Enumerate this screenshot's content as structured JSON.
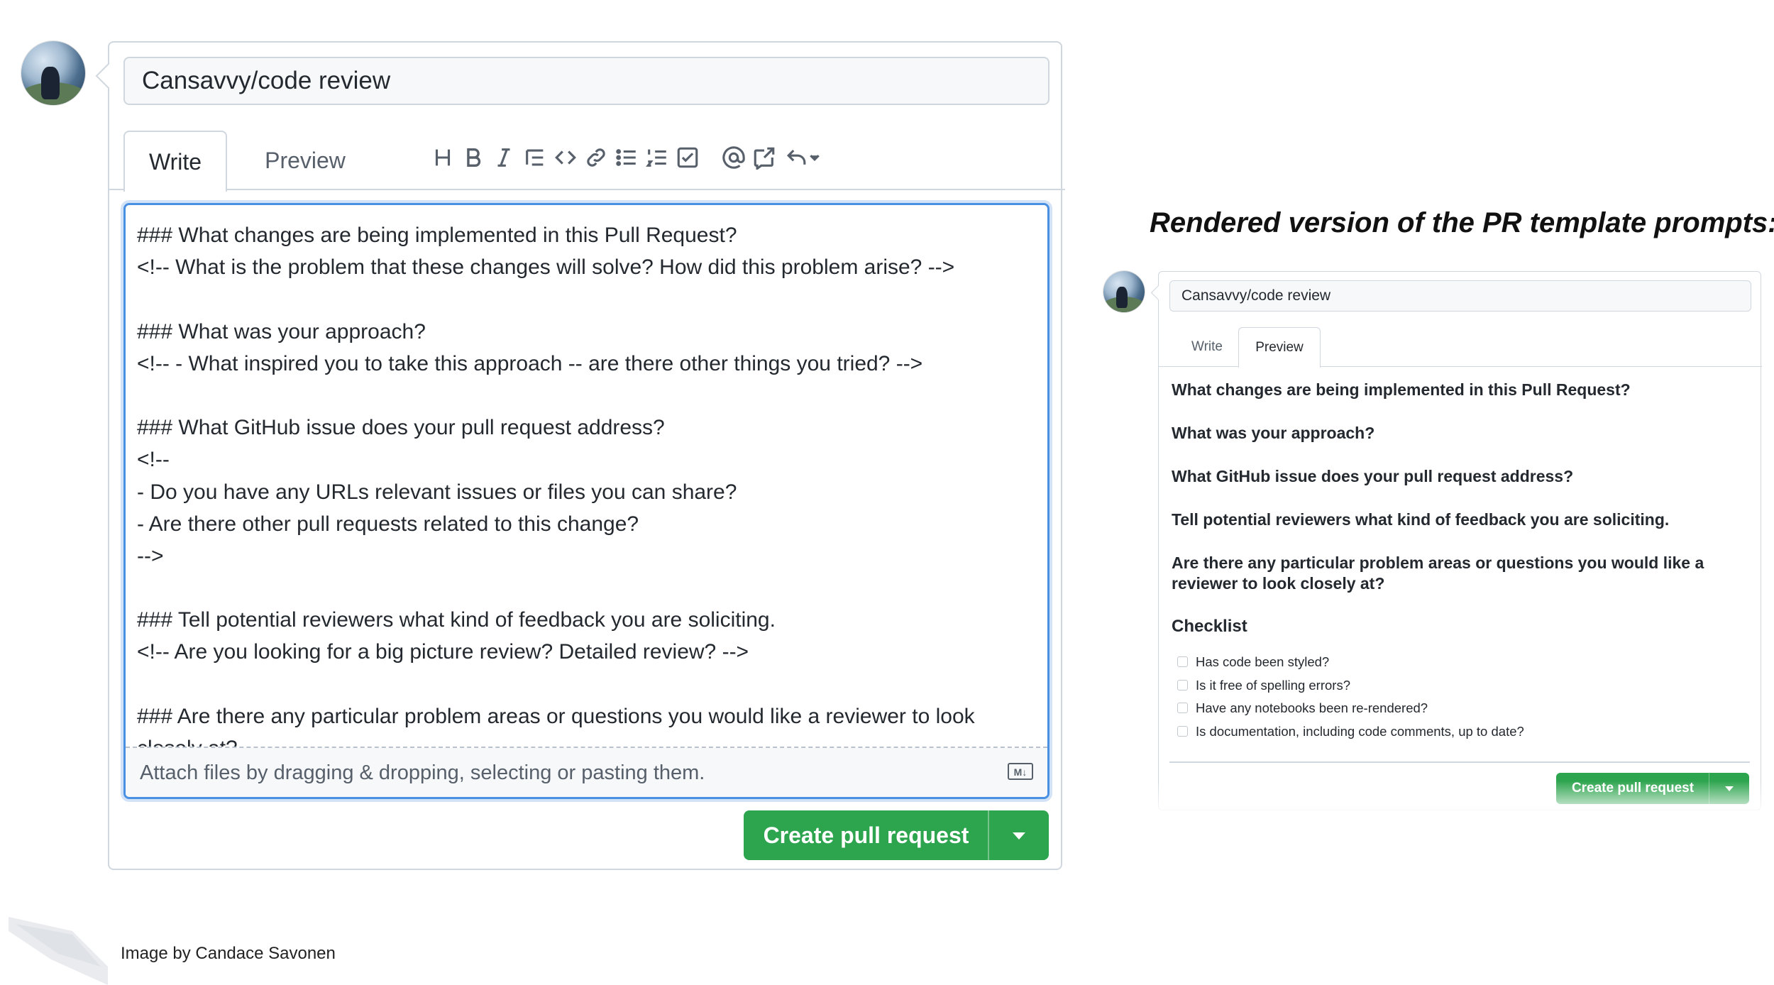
{
  "left_editor": {
    "title_value": "Cansavvy/code review",
    "tabs": [
      "Write",
      "Preview"
    ],
    "toolbar_icons": [
      "heading-icon",
      "bold-icon",
      "italic-icon",
      "quote-icon",
      "code-icon",
      "link-icon",
      "bulleted-list-icon",
      "numbered-list-icon",
      "task-list-icon",
      "mention-icon",
      "reference-icon",
      "reply-icon"
    ],
    "lines": [
      "### What changes are being implemented in this Pull Request?",
      "<!-- What is the problem that these changes will solve? How did this problem arise? -->",
      "",
      "### What was your approach?",
      "<!-- - What inspired you to take this approach -- are there other things you tried? -->",
      "",
      "### What GitHub issue does your pull request address?",
      "<!--",
      "- Do you have any URLs relevant issues or files you can share?",
      "- Are there other pull requests related to this change?",
      "-->",
      "",
      "### Tell potential reviewers what kind of feedback you are soliciting.",
      "<!-- Are you looking for a big picture review? Detailed review? -->",
      "",
      "### Are there any particular problem areas or questions you would like a reviewer to look",
      "closely at?"
    ],
    "attach_text": "Attach files by dragging & dropping, selecting or pasting them.",
    "create_button": "Create pull request"
  },
  "rendered_heading": "Rendered version of the PR template prompts:",
  "right_preview": {
    "title_value": "Cansavvy/code review",
    "tabs": [
      "Write",
      "Preview"
    ],
    "headings": [
      "What changes are being implemented in this Pull Request?",
      "What was your approach?",
      "What GitHub issue does your pull request address?",
      "Tell potential reviewers what kind of feedback you are soliciting.",
      "Are there any particular problem areas or questions you would like a reviewer to look closely at?"
    ],
    "checklist_title": "Checklist",
    "checklist": [
      "Has code been styled?",
      "Is it free of spelling errors?",
      "Have any notebooks been re-rendered?",
      "Is documentation, including code comments, up to date?"
    ],
    "create_button": "Create pull request"
  },
  "credit": "Image by Candace Savonen",
  "colors": {
    "accent_blue": "#4a90e2",
    "button_green": "#2da44e",
    "border": "#d0d7de"
  }
}
